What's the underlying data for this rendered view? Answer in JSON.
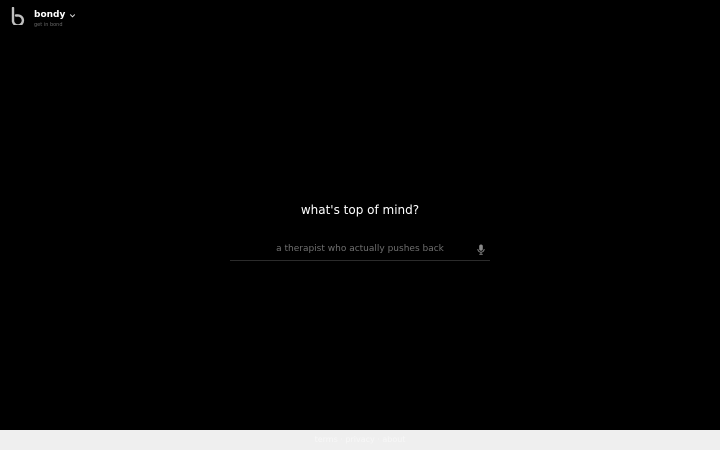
{
  "brand": {
    "name": "bondy",
    "tagline": "get in bond",
    "logo_icon": "bondy-logo-icon",
    "menu_icon": "chevron-down-icon"
  },
  "main": {
    "title": "what's top of mind?",
    "input": {
      "value": "",
      "placeholder": "a therapist who actually pushes back"
    },
    "mic_icon": "microphone-icon"
  },
  "footer": {
    "text": "terms · privacy · about"
  },
  "colors": {
    "background": "#000000",
    "text": "#ffffff",
    "muted": "#6f6f6f",
    "divider": "#2b2b2b",
    "footer_bg": "#efefef"
  }
}
